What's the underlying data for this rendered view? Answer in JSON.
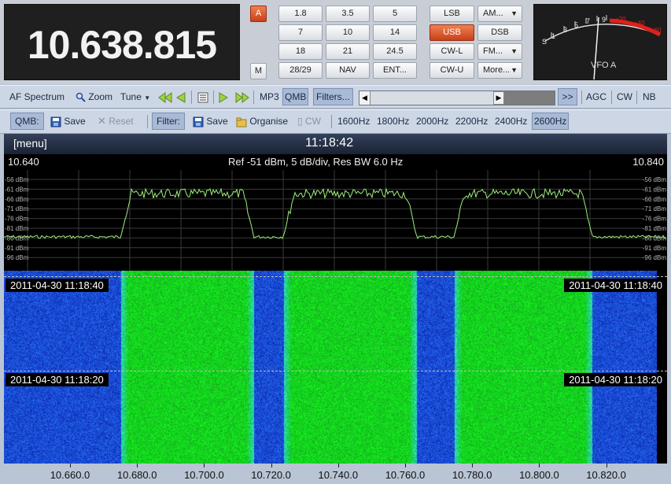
{
  "frequency_display": "10.638.815",
  "band_buttons": [
    "1.8",
    "3.5",
    "5",
    "7",
    "10",
    "14",
    "18",
    "21",
    "24.5",
    "28/29",
    "NAV",
    "ENT..."
  ],
  "mode_buttons": {
    "lsb": "LSB",
    "usb": "USB",
    "cwl": "CW-L",
    "cwu": "CW-U",
    "am": "AM...",
    "dsb": "DSB",
    "fm": "FM...",
    "more": "More..."
  },
  "a_button": "A",
  "m_button": "M",
  "meter": {
    "label": "VFO A",
    "scale_white": [
      "S",
      "1",
      "3",
      "5",
      "7",
      "9"
    ],
    "scale_red": [
      "+20",
      "+40",
      "+60"
    ]
  },
  "toolbar1": {
    "af_spectrum": "AF Spectrum",
    "zoom": "Zoom",
    "tune": "Tune",
    "mp3": "MP3",
    "qmb": "QMB",
    "filters": "Filters...",
    "ff": ">>",
    "agc": "AGC",
    "cw": "CW",
    "nb": "NB"
  },
  "toolbar2": {
    "qmb_label": "QMB:",
    "save": "Save",
    "reset": "Reset",
    "filter_label": "Filter:",
    "save2": "Save",
    "organise": "Organise",
    "cw": "CW",
    "filters": [
      "1600Hz",
      "1800Hz",
      "2000Hz",
      "2200Hz",
      "2400Hz",
      "2600Hz"
    ],
    "selected_filter": "2600Hz"
  },
  "spectrum": {
    "menu": "[menu]",
    "clock": "11:18:42",
    "left_freq": "10.640",
    "right_freq": "10.840",
    "info": "Ref -51 dBm,  5 dB/div,  Res BW 6.0 Hz",
    "db_labels": [
      "-56 dBm",
      "-61 dBm",
      "-66 dBm",
      "-71 dBm",
      "-76 dBm",
      "-81 dBm",
      "-86 dBm",
      "-91 dBm",
      "-96 dBm"
    ],
    "waterfall_timestamps": [
      "2011-04-30  11:18:40",
      "2011-04-30  11:18:20"
    ],
    "freq_axis": [
      "10.660.0",
      "10.680.0",
      "10.700.0",
      "10.720.0",
      "10.740.0",
      "10.760.0",
      "10.780.0",
      "10.800.0",
      "10.820.0"
    ]
  },
  "colors": {
    "accent_orange": "#d9501f",
    "spectrum_trace": "#9cf07c",
    "waterfall_blue": "#1a3ad8",
    "waterfall_green": "#38e030",
    "meter_red": "#e0201a"
  }
}
